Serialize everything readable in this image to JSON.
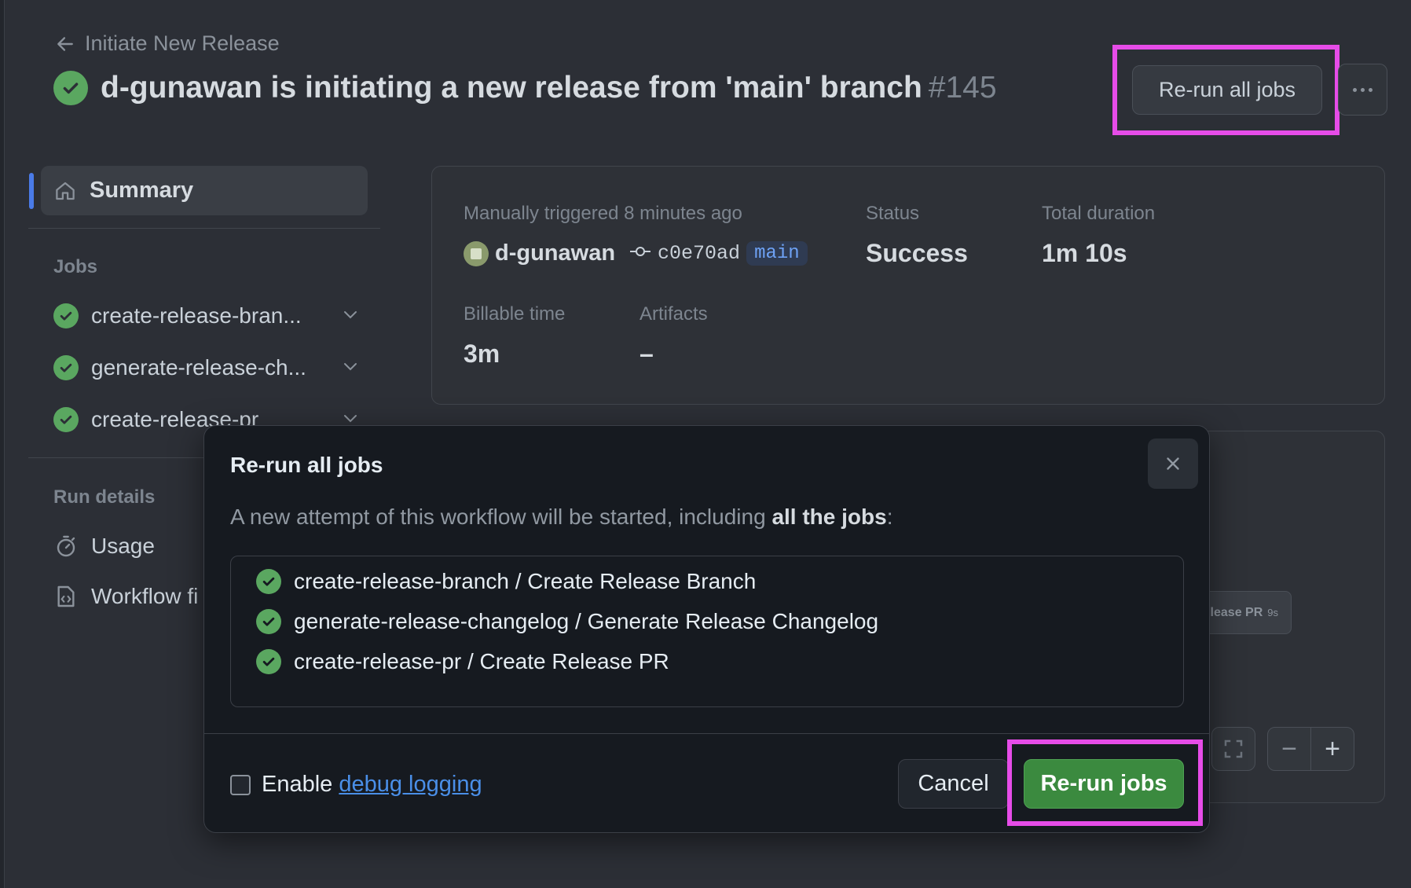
{
  "header": {
    "back_label": "Initiate New Release",
    "title": "d-gunawan is initiating a new release from 'main' branch",
    "run_number": "#145",
    "rerun_all_label": "Re-run all jobs"
  },
  "sidebar": {
    "summary_label": "Summary",
    "jobs_heading": "Jobs",
    "jobs": [
      {
        "name": "create-release-bran..."
      },
      {
        "name": "generate-release-ch..."
      },
      {
        "name": "create-release-pr"
      }
    ],
    "run_details_heading": "Run details",
    "run_items": [
      {
        "label": "Usage"
      },
      {
        "label": "Workflow fi"
      }
    ]
  },
  "summary": {
    "trigger_label": "Manually triggered 8 minutes ago",
    "actor": "d-gunawan",
    "commit_sha": "c0e70ad",
    "branch": "main",
    "status_label": "Status",
    "status_value": "Success",
    "duration_label": "Total duration",
    "duration_value": "1m 10s",
    "billable_label": "Billable time",
    "billable_value": "3m",
    "artifacts_label": "Artifacts",
    "artifacts_value": "–"
  },
  "graph": {
    "node_label": "lease PR",
    "node_duration": "9s",
    "zoom_out": "−",
    "zoom_in": "+"
  },
  "dialog": {
    "title": "Re-run all jobs",
    "desc_prefix": "A new attempt of this workflow will be started, including ",
    "desc_bold": "all the jobs",
    "desc_suffix": ":",
    "jobs": [
      {
        "name": "create-release-branch / Create Release Branch"
      },
      {
        "name": "generate-release-changelog / Generate Release Changelog"
      },
      {
        "name": "create-release-pr / Create Release PR"
      }
    ],
    "debug_prefix": "Enable ",
    "debug_link": "debug logging",
    "cancel_label": "Cancel",
    "confirm_label": "Re-run jobs"
  },
  "colors": {
    "success": "#5aa760",
    "primary_button": "#3b8a3f",
    "highlight": "#e64ce8",
    "link": "#4a8fe8"
  }
}
